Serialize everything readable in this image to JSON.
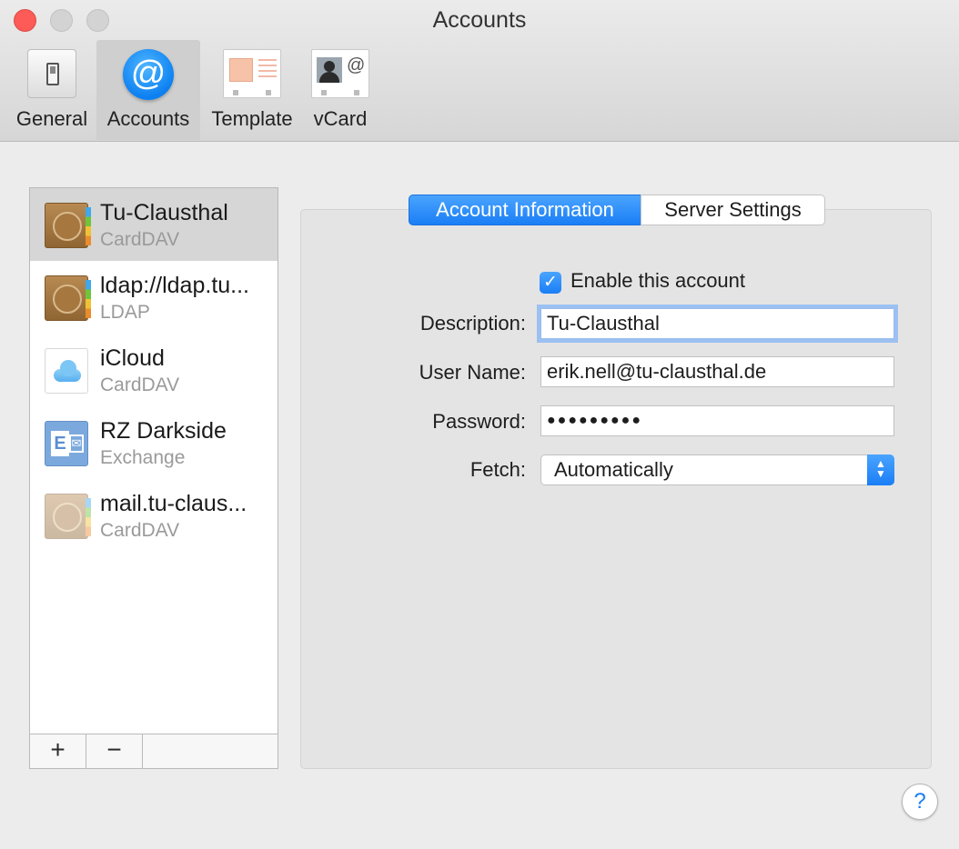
{
  "window": {
    "title": "Accounts"
  },
  "toolbar": {
    "items": [
      {
        "label": "General",
        "icon": "general-switch-icon"
      },
      {
        "label": "Accounts",
        "icon": "at-sign-icon",
        "glyph": "@",
        "selected": true
      },
      {
        "label": "Template",
        "icon": "template-icon"
      },
      {
        "label": "vCard",
        "icon": "vcard-icon",
        "glyph": "@"
      }
    ]
  },
  "accounts": [
    {
      "name": "Tu-Clausthal",
      "type": "CardDAV",
      "icon": "contacts-book-icon",
      "selected": true
    },
    {
      "name": "ldap://ldap.tu...",
      "type": "LDAP",
      "icon": "contacts-book-icon"
    },
    {
      "name": "iCloud",
      "type": "CardDAV",
      "icon": "icloud-icon"
    },
    {
      "name": "RZ Darkside",
      "type": "Exchange",
      "icon": "exchange-icon"
    },
    {
      "name": "mail.tu-claus...",
      "type": "CardDAV",
      "icon": "contacts-book-icon",
      "disabled": true
    }
  ],
  "list_buttons": {
    "add": "+",
    "remove": "−"
  },
  "tabs": {
    "active": "Account Information",
    "inactive": "Server Settings"
  },
  "form": {
    "enable_label": "Enable this account",
    "enable_checked": true,
    "checkmark": "✓",
    "description_label": "Description:",
    "description_value": "Tu-Clausthal",
    "username_label": "User Name:",
    "username_value": "erik.nell@tu-clausthal.de",
    "password_label": "Password:",
    "password_value": "●●●●●●●●●",
    "fetch_label": "Fetch:",
    "fetch_value": "Automatically",
    "fetch_arrows": "▲▼"
  },
  "help": "?",
  "colors": {
    "accent": "#1a7ef5",
    "close": "#fc5b57",
    "selection": "#d6d6d6"
  }
}
